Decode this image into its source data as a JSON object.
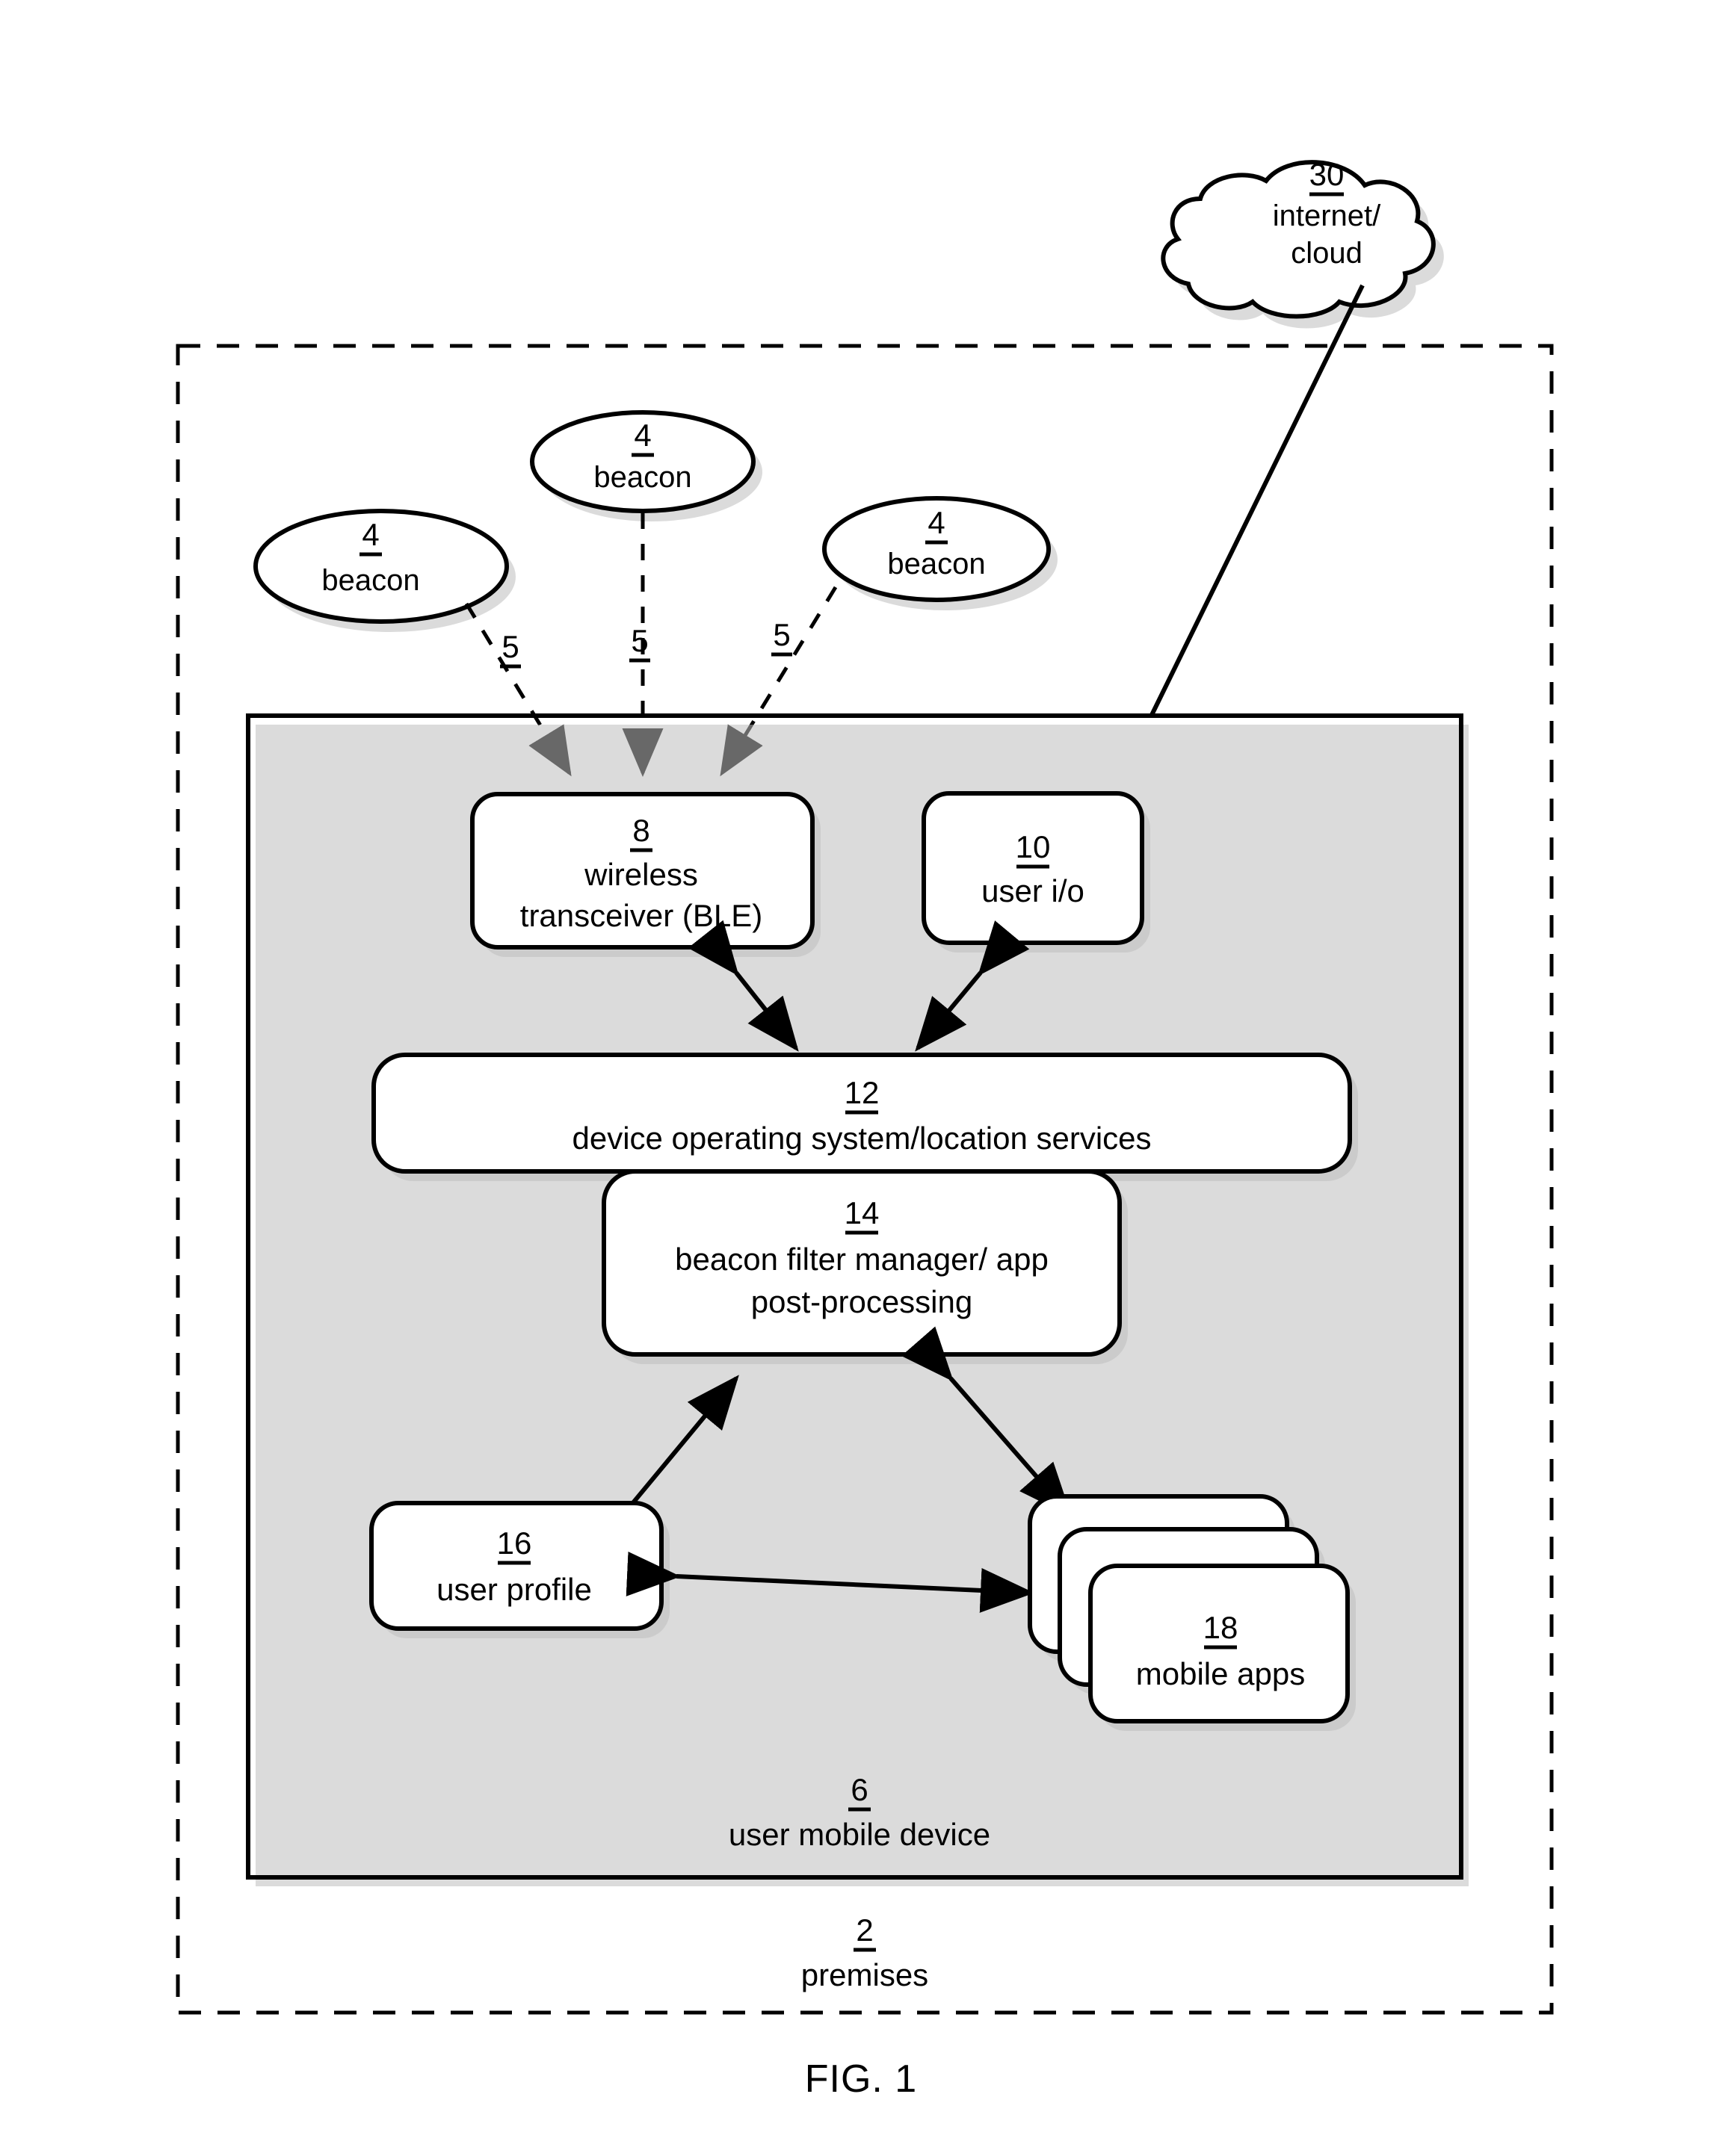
{
  "figure": {
    "caption": "FIG. 1",
    "premises": {
      "ref": "2",
      "label": "premises"
    },
    "device": {
      "ref": "6",
      "label": "user mobile device"
    },
    "cloud": {
      "ref": "30",
      "label_line1": "internet/",
      "label_line2": "cloud"
    },
    "beacons": [
      {
        "ref": "4",
        "label": "beacon",
        "signal_ref": "5"
      },
      {
        "ref": "4",
        "label": "beacon",
        "signal_ref": "5"
      },
      {
        "ref": "4",
        "label": "beacon",
        "signal_ref": "5"
      }
    ],
    "blocks": [
      {
        "ref": "8",
        "label_line1": "wireless",
        "label_line2": "transceiver (BLE)"
      },
      {
        "ref": "10",
        "label_line1": "user i/o",
        "label_line2": ""
      },
      {
        "ref": "12",
        "label_line1": "device operating system/location services",
        "label_line2": ""
      },
      {
        "ref": "14",
        "label_line1": "beacon filter manager/ app",
        "label_line2": "post-processing"
      },
      {
        "ref": "16",
        "label_line1": "user profile",
        "label_line2": ""
      },
      {
        "ref": "18",
        "label_line1": "mobile apps",
        "label_line2": ""
      }
    ],
    "colors": {
      "ink": "#000000",
      "paper": "#ffffff",
      "shadow": "#bdbdbd"
    }
  }
}
